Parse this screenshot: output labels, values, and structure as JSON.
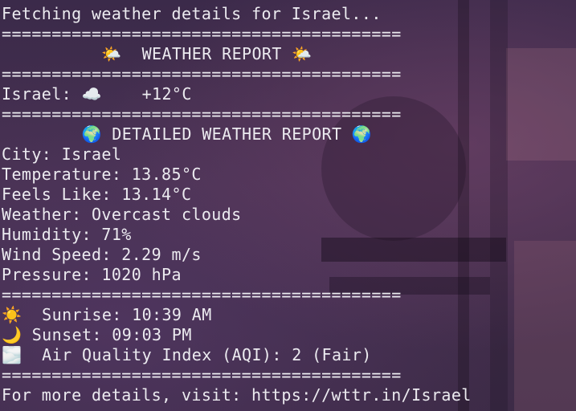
{
  "lines": [
    "Fetching weather details for Israel...",
    "========================================",
    "          🌤️  WEATHER REPORT 🌤️",
    "========================================",
    "Israel: ☁️    +12°C",
    "========================================",
    "        🌍 DETAILED WEATHER REPORT 🌍",
    "City: Israel",
    "Temperature: 13.85°C",
    "Feels Like: 13.14°C",
    "Weather: Overcast clouds",
    "Humidity: 71%",
    "Wind Speed: 2.29 m/s",
    "Pressure: 1020 hPa",
    "========================================",
    "☀️  Sunrise: 10:39 AM",
    "🌙 Sunset: 09:03 PM",
    "🌫️  Air Quality Index (AQI): 2 (Fair)",
    "========================================",
    "For more details, visit: https://wttr.in/Israel"
  ]
}
